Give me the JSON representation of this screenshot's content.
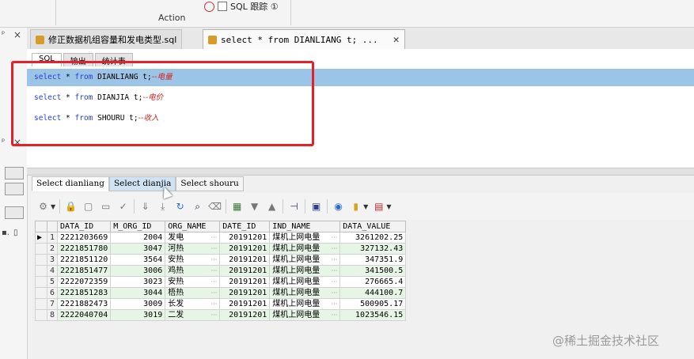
{
  "ribbon": {
    "group_label": "Action",
    "sql_trace_label": "SQL 跟踪 ①"
  },
  "tabs": [
    {
      "label": "修正数据机组容量和发电类型.sql",
      "active": false
    },
    {
      "label": "select * from DIANLIANG t; ...",
      "active": true
    }
  ],
  "editor_tabs": [
    "SQL",
    "输出",
    "统计表"
  ],
  "sql": [
    {
      "kw1": "select",
      "star": " * ",
      "kw2": "from",
      "rest": " DIANLIANG t;",
      "comment": "--电量",
      "highlighted": true
    },
    {
      "kw1": "select",
      "star": " * ",
      "kw2": "from",
      "rest": " DIANJIA t;",
      "comment": "--电价",
      "highlighted": false
    },
    {
      "kw1": "select",
      "star": " * ",
      "kw2": "from",
      "rest": " SHOURU t;",
      "comment": "--收入",
      "highlighted": false
    }
  ],
  "result_tabs": [
    "Select dianliang",
    "Select dianjia",
    "Select shouru"
  ],
  "grid": {
    "columns": [
      "DATA_ID",
      "M_ORG_ID",
      "ORG_NAME",
      "DATE_ID",
      "IND_NAME",
      "DATA_VALUE"
    ],
    "rows": [
      [
        "1",
        "2221203669",
        "2004",
        "发电",
        "20191201",
        "煤机上网电量",
        "3261202.25"
      ],
      [
        "2",
        "2221851780",
        "3047",
        "河热",
        "20191201",
        "煤机上网电量",
        "327132.43"
      ],
      [
        "3",
        "2221851120",
        "3564",
        "安热",
        "20191201",
        "煤机上网电量",
        "347351.9"
      ],
      [
        "4",
        "2221851477",
        "3006",
        "鸡热",
        "20191201",
        "煤机上网电量",
        "341500.5"
      ],
      [
        "5",
        "2222072359",
        "3023",
        "安热",
        "20191201",
        "煤机上网电量",
        "276665.4"
      ],
      [
        "6",
        "2221851283",
        "3044",
        "梧热",
        "20191201",
        "煤机上网电量",
        "444100.7"
      ],
      [
        "7",
        "2221882473",
        "3009",
        "长发",
        "20191201",
        "煤机上网电量",
        "500905.17"
      ],
      [
        "8",
        "2222040704",
        "3019",
        "二发",
        "20191201",
        "煤机上网电量",
        "1023546.15"
      ]
    ]
  },
  "watermark": "@稀土掘金技术社区",
  "colors": {
    "highlight": "#9cc4e6",
    "annotation": "#e5202a",
    "row_alt": "#e7f5e7",
    "keyword": "#2a3fd6",
    "comment": "#d6201f"
  }
}
